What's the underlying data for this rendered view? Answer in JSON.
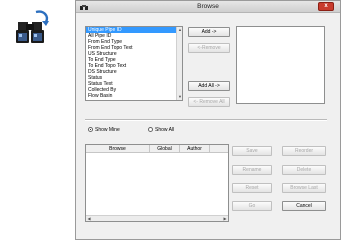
{
  "dialog": {
    "title": "Browse",
    "close_label": "x"
  },
  "field_list": {
    "items": [
      "Unique Pipe ID",
      "All Pipe ID",
      "From End Type",
      "From End Topo Text",
      "US Structure",
      "To End Type",
      "To End Topo Text",
      "DS Structure",
      "Status",
      "Status Text",
      "Collected By",
      "Flow Basin"
    ],
    "selected_index": 0
  },
  "buttons": {
    "add": "Add ->",
    "remove": "<-Remove",
    "add_all": "Add All ->",
    "remove_all": "<- Remove All",
    "save": "Save",
    "rename": "Rename",
    "reset": "Reset",
    "go": "Go",
    "reorder": "Reorder",
    "delete": "Delete",
    "browse_last": "Browse Last",
    "cancel": "Cancel"
  },
  "filter": {
    "show_mine": "Show Mine",
    "show_all": "Show All",
    "selected": "show_mine"
  },
  "table": {
    "columns": [
      "Browse",
      "Global",
      "Author"
    ]
  },
  "icons": {
    "tool": "binoculars-arrow-icon",
    "app": "app-icon"
  }
}
